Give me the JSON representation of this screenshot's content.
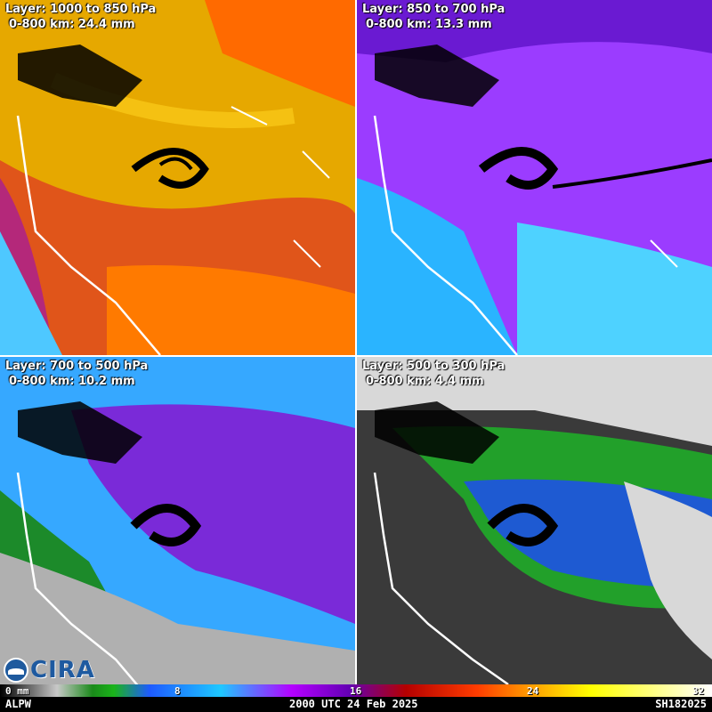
{
  "panels": [
    {
      "layer": "Layer: 1000 to 850 hPa",
      "value": "0-800 km: 24.4 mm",
      "colors": [
        "#e6a800",
        "#d9c200",
        "#ff7a00",
        "#d23a00",
        "#ffd21e"
      ]
    },
    {
      "layer": "Layer: 850 to 700 hPa",
      "value": "0-800 km: 13.3 mm",
      "colors": [
        "#9b3cff",
        "#6a1ad2",
        "#2ab4ff",
        "#4ed2ff",
        "#c040ff"
      ]
    },
    {
      "layer": "Layer: 700 to 500 hPa",
      "value": "0-800 km: 10.2 mm",
      "colors": [
        "#7a2ad8",
        "#36a8ff",
        "#1c8a2a",
        "#b0b0b0",
        "#9c40f0"
      ]
    },
    {
      "layer": "Layer: 500 to 300 hPa",
      "value": "0-800 km: 4.4 mm",
      "colors": [
        "#1e5ad2",
        "#22a02a",
        "#8a8a8a",
        "#3a3a3a",
        "#d8d8d8"
      ]
    }
  ],
  "colorbar": {
    "ticks": [
      "0 mm",
      "8",
      "16",
      "24",
      "32"
    ],
    "tick_values": [
      0,
      8,
      16,
      24,
      32
    ]
  },
  "footer": {
    "left": "ALPW",
    "center": "2000 UTC 24 Feb 2025",
    "right": "SH182025"
  },
  "logo": {
    "text": "CIRA",
    "icon": "noaa-logo-icon"
  }
}
